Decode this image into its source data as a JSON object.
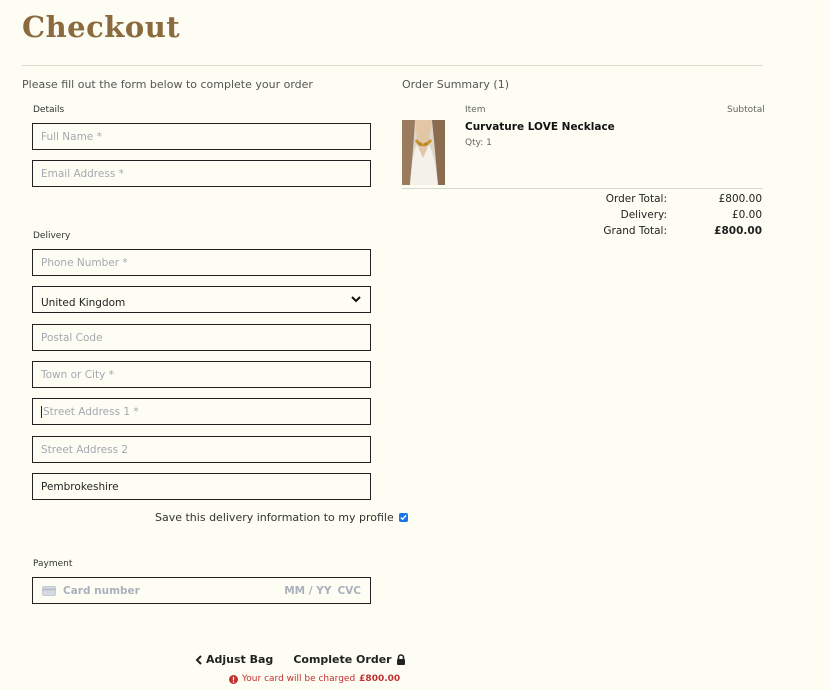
{
  "page": {
    "title": "Checkout",
    "intro": "Please fill out the form below to complete your order"
  },
  "form": {
    "details_label": "Details",
    "full_name_placeholder": "Full Name *",
    "email_placeholder": "Email Address *",
    "delivery_label": "Delivery",
    "phone_placeholder": "Phone Number *",
    "country_value": "United Kingdom",
    "postal_placeholder": "Postal Code",
    "town_placeholder": "Town or City *",
    "street1_placeholder": "Street Address 1 *",
    "street2_placeholder": "Street Address 2",
    "county_value": "Pembrokeshire",
    "save_info_label": "Save this delivery information to my profile",
    "save_info_checked": true,
    "payment_label": "Payment",
    "card_number_placeholder": "Card number",
    "card_expiry_placeholder": "MM / YY",
    "card_cvc_placeholder": "CVC"
  },
  "actions": {
    "adjust_bag": "Adjust Bag",
    "complete_order": "Complete Order",
    "charge_prefix": "Your card will be charged",
    "charge_amount": "£800.00"
  },
  "summary": {
    "title": "Order Summary (1)",
    "col_item": "Item",
    "col_subtotal": "Subtotal",
    "product_name": "Curvature LOVE Necklace",
    "product_qty": "Qty: 1",
    "order_total_label": "Order Total:",
    "order_total": "£800.00",
    "delivery_label": "Delivery:",
    "delivery": "£0.00",
    "grand_total_label": "Grand Total:",
    "grand_total": "£800.00"
  },
  "colors": {
    "background": "#fdfdf3",
    "title": "#8a6a3e",
    "error": "#c53030",
    "checkbox": "#1a73e8"
  }
}
